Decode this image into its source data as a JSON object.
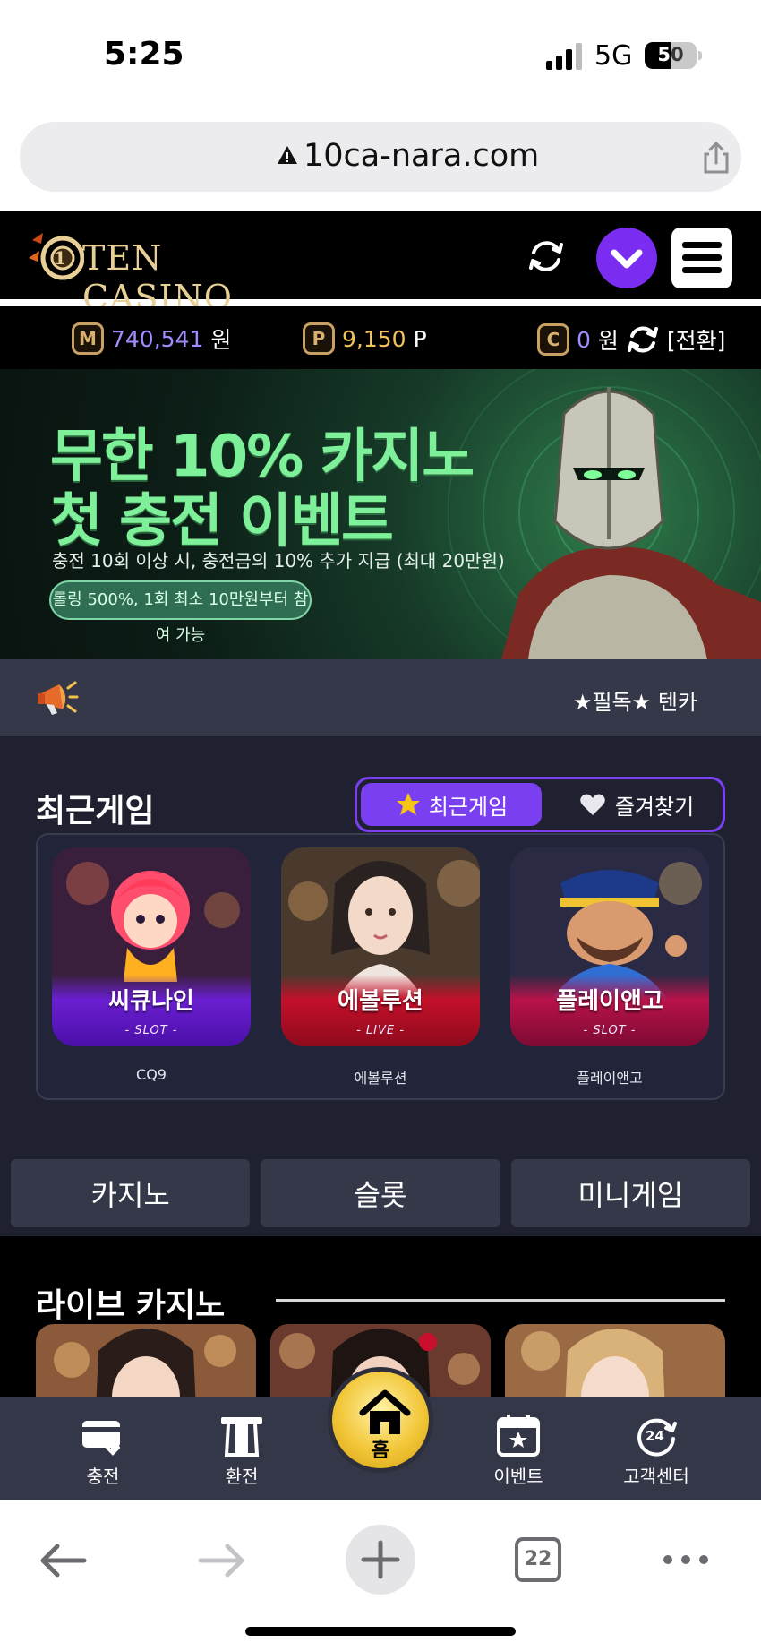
{
  "status_bar": {
    "time": "5:25",
    "network": "5G",
    "battery": "50",
    "battery_level": 0.5
  },
  "browser": {
    "url": "10ca-nara.com",
    "tab_count": "22"
  },
  "site": {
    "logo_text": "TEN CASINO",
    "balance": {
      "money_badge": "M",
      "money_value": "740,541",
      "money_unit": "원",
      "point_badge": "P",
      "point_value": "9,150",
      "point_unit": "P",
      "comp_badge": "C",
      "comp_value": "0",
      "comp_unit": "원",
      "swap_label": "[전환]"
    },
    "banner": {
      "title_line1": "무한 10% 카지노",
      "title_line2": "첫 충전 이벤트",
      "subtitle": "충전 10회 이상 시, 충전금의 10% 추가 지급 (최대 20만원)",
      "pill": "롤링 500%, 1회 최소 10만원부터 참여 가능"
    },
    "notice": {
      "text": "★필독★ 텐카"
    },
    "recent": {
      "title": "최근게임",
      "tab_recent": "최근게임",
      "tab_favorites": "즐겨찾기",
      "games": [
        {
          "name": "씨큐나인",
          "kind": "- SLOT -",
          "caption": "CQ9"
        },
        {
          "name": "에볼루션",
          "kind": "- LIVE -",
          "caption": "에볼루션"
        },
        {
          "name": "플레이앤고",
          "kind": "- SLOT -",
          "caption": "플레이앤고"
        }
      ]
    },
    "categories": [
      "카지노",
      "슬롯",
      "미니게임"
    ],
    "live": {
      "title": "라이브 카지노"
    },
    "bottom_nav": {
      "charge": "충전",
      "exchange": "환전",
      "home": "홈",
      "events": "이벤트",
      "support": "고객센터"
    }
  },
  "colors": {
    "accent_purple": "#7b3ff2",
    "gold": "#f2c638",
    "panel_dark": "#1f2131",
    "balance_purple": "#a48bff",
    "balance_gold": "#f1c25a"
  },
  "icons": [
    "signal-icon",
    "warning-icon",
    "share-icon",
    "refresh-icon",
    "chevron-down-icon",
    "hamburger-menu-icon",
    "swap-icon",
    "megaphone-icon",
    "star-icon",
    "heart-icon",
    "card-icon",
    "atm-icon",
    "home-icon",
    "calendar-star-icon",
    "support-24-icon",
    "back-arrow-icon",
    "forward-arrow-icon",
    "plus-icon",
    "more-icon"
  ]
}
